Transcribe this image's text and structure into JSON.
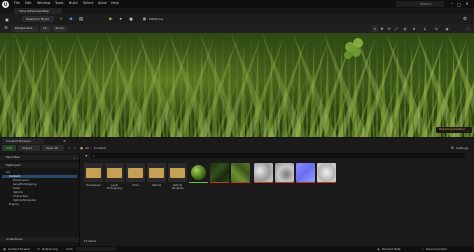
{
  "app": {
    "logo": "unreal-logo",
    "project": "VehicleExampleMap",
    "menu": [
      "File",
      "Edit",
      "Window",
      "Tools",
      "Build",
      "Select",
      "Actor",
      "Help"
    ],
    "search_placeholder": "Search"
  },
  "toolbar": {
    "mode_label": "Selection Mode",
    "platforms_label": "Platforms"
  },
  "viewport": {
    "perspective_label": "Perspective",
    "lit_label": "Lit",
    "show_label": "Show",
    "badge": "Streaming Disabled"
  },
  "content_browser": {
    "tab_label": "Content Browser",
    "add_label": "Add",
    "import_label": "Import",
    "save_all_label": "Save All",
    "all_label": "All",
    "content_label": "Content",
    "settings_label": "Settings",
    "favorites_label": "Favorites",
    "project_label": "MyProject",
    "tree": [
      "All",
      "Content",
      "Developers",
      "LevelPrototyping",
      "Tools",
      "Vehicle",
      "Characters",
      "VehicleTemplate",
      "Engine"
    ],
    "items_count": "11 items",
    "collections_label": "Collections",
    "assets": [
      {
        "label": "Developers",
        "kind": "folder"
      },
      {
        "label": "Level Prototyping",
        "kind": "folder"
      },
      {
        "label": "Tools",
        "kind": "folder"
      },
      {
        "label": "Vehicle",
        "kind": "folder"
      },
      {
        "label": "Vehicle Template",
        "kind": "folder"
      },
      {
        "label": "",
        "kind": "material-sphere"
      },
      {
        "label": "",
        "kind": "grass-texture"
      },
      {
        "label": "",
        "kind": "grass-texture"
      },
      {
        "label": "",
        "kind": "grayscale-texture"
      },
      {
        "label": "",
        "kind": "grayscale-texture"
      },
      {
        "label": "",
        "kind": "normal-map"
      },
      {
        "label": "",
        "kind": "grayscale-texture"
      }
    ]
  },
  "status": {
    "drawer_label": "Content Drawer",
    "output_label": "Output Log",
    "cmd_label": "Cmd",
    "derived_label": "Derived Data",
    "source_label": "Source Control"
  }
}
